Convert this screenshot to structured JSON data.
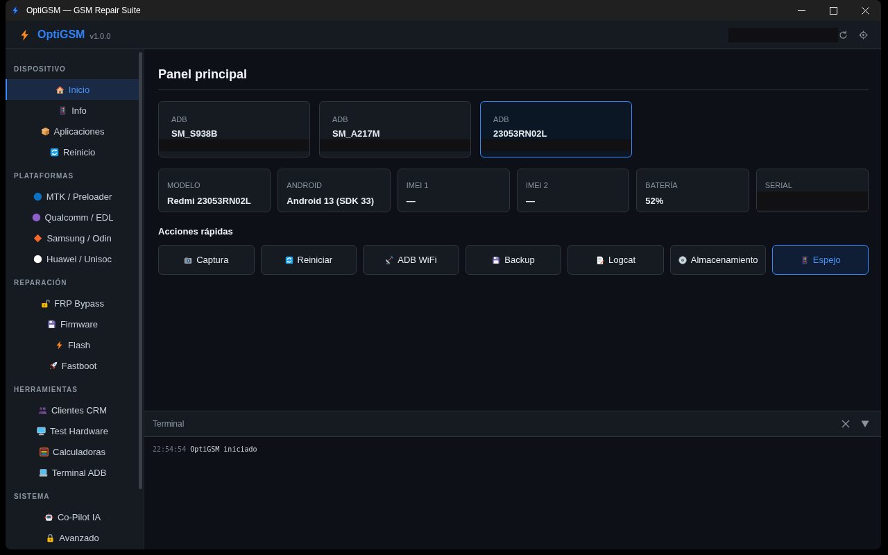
{
  "window": {
    "title": "OptiGSM — GSM Repair Suite"
  },
  "header": {
    "app_name": "OptiGSM",
    "version": "v1.0.0",
    "redacted": true
  },
  "sidebar": {
    "sections": [
      {
        "title": "DISPOSITIVO",
        "items": [
          {
            "label": "Inicio",
            "selected": true
          },
          {
            "label": "Info",
            "selected": false
          },
          {
            "label": "Aplicaciones",
            "selected": false
          },
          {
            "label": "Reinicio",
            "selected": false
          }
        ]
      },
      {
        "title": "PLATAFORMAS",
        "items": [
          {
            "label": "MTK / Preloader",
            "selected": false,
            "color": "#0a72c4"
          },
          {
            "label": "Qualcomm / EDL",
            "selected": false,
            "color": "#8e5fc8"
          },
          {
            "label": "Samsung / Odin",
            "selected": false,
            "color": "#f4672c"
          },
          {
            "label": "Huawei / Unisoc",
            "selected": false,
            "color": "#ffffff"
          }
        ]
      },
      {
        "title": "REPARACIÓN",
        "items": [
          {
            "label": "FRP Bypass",
            "selected": false
          },
          {
            "label": "Firmware",
            "selected": false
          },
          {
            "label": "Flash",
            "selected": false
          },
          {
            "label": "Fastboot",
            "selected": false
          }
        ]
      },
      {
        "title": "HERRAMIENTAS",
        "items": [
          {
            "label": "Clientes CRM",
            "selected": false
          },
          {
            "label": "Test Hardware",
            "selected": false
          },
          {
            "label": "Calculadoras",
            "selected": false
          },
          {
            "label": "Terminal ADB",
            "selected": false
          }
        ]
      },
      {
        "title": "SISTEMA",
        "items": [
          {
            "label": "Co-Pilot IA",
            "selected": false
          },
          {
            "label": "Avanzado",
            "selected": false
          }
        ]
      }
    ]
  },
  "main": {
    "title": "Panel principal",
    "devices": [
      {
        "connection": "ADB",
        "name": "SM_S938B",
        "selected": false,
        "redacted": true
      },
      {
        "connection": "ADB",
        "name": "SM_A217M",
        "selected": false,
        "redacted": true
      },
      {
        "connection": "ADB",
        "name": "23053RN02L",
        "selected": true,
        "redacted": true
      }
    ],
    "info_cards": [
      {
        "label": "MODELO",
        "value": "Redmi 23053RN02L"
      },
      {
        "label": "ANDROID",
        "value": "Android 13 (SDK 33)"
      },
      {
        "label": "IMEI 1",
        "value": "—"
      },
      {
        "label": "IMEI 2",
        "value": "—"
      },
      {
        "label": "BATERÍA",
        "value": "52%"
      },
      {
        "label": "SERIAL",
        "redacted": true
      }
    ],
    "quick_actions": {
      "title": "Acciones rápidas",
      "buttons": [
        {
          "label": "Captura",
          "selected": false
        },
        {
          "label": "Reiniciar",
          "selected": false
        },
        {
          "label": "ADB WiFi",
          "selected": false
        },
        {
          "label": "Backup",
          "selected": false
        },
        {
          "label": "Logcat",
          "selected": false
        },
        {
          "label": "Almacenamiento",
          "selected": false
        },
        {
          "label": "Espejo",
          "selected": true
        }
      ]
    }
  },
  "terminal": {
    "title": "Terminal",
    "lines": [
      {
        "time": "22:54:54",
        "message": "OptiGSM iniciado"
      }
    ]
  }
}
